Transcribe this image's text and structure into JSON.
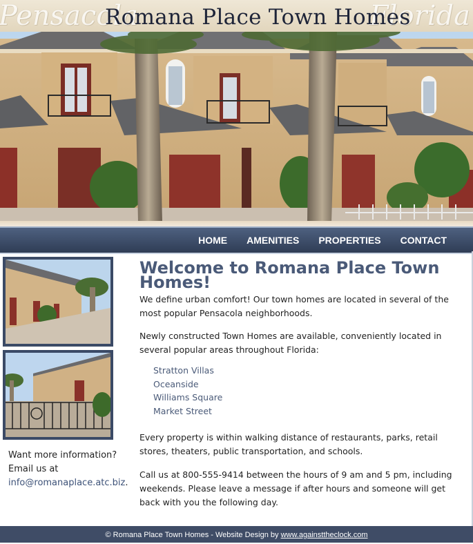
{
  "header": {
    "script_left": "Pensacola",
    "site_title": "Romana Place Town Homes",
    "script_right": "Florida"
  },
  "nav": {
    "items": [
      {
        "label": "HOME"
      },
      {
        "label": "AMENITIES"
      },
      {
        "label": "PROPERTIES"
      },
      {
        "label": "CONTACT"
      }
    ]
  },
  "sidebar": {
    "info_line1": "Want more information?",
    "info_line2": "Email us at",
    "email": "info@romanaplace.atc.biz",
    "email_suffix": "."
  },
  "main": {
    "heading": "Welcome to Romana Place Town Homes!",
    "paragraph1": "We define urban comfort! Our town homes are located in several of the most popular Pensacola neighborhoods.",
    "paragraph2": "Newly constructed Town Homes are available, conveniently located in several popular areas throughout Florida:",
    "areas": [
      "Stratton Villas",
      "Oceanside",
      "Williams Square",
      "Market Street"
    ],
    "paragraph3": "Every property is within walking distance of restaurants, parks, retail stores, theaters, public transportation, and schools.",
    "paragraph4": "Call us at 800-555-9414 between the hours of 9 am and 5 pm, including weekends. Please leave a message if after hours and someone will get back with you the following day."
  },
  "footer": {
    "text": "© Romana Place Town Homes - Website Design by ",
    "link": "www.againsttheclock.com"
  },
  "colors": {
    "nav_bg": "#3f4c66",
    "heading": "#4a5a78",
    "link": "#3d5278",
    "footer_bg": "#3f4c66"
  }
}
